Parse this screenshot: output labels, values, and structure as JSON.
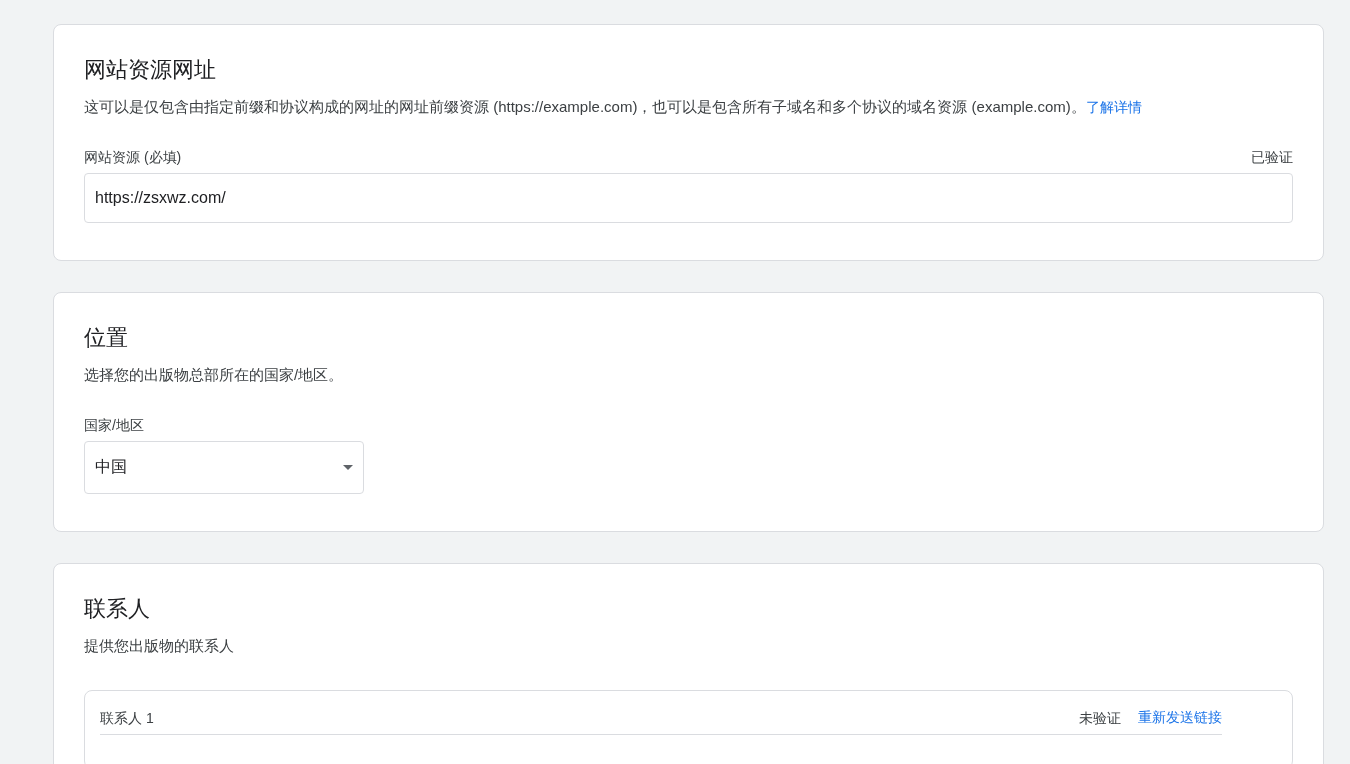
{
  "sections": [
    {
      "kind": "url",
      "title": "网站资源网址",
      "description": "这可以是仅包含由指定前缀和协议构成的网址的网址前缀资源 (https://example.com)，也可以是包含所有子域名和多个协议的域名资源 (example.com)。",
      "link": "了解详情",
      "field": {
        "label": "网站资源 (必填)",
        "status": "已验证",
        "value": "https://zsxwz.com/"
      }
    },
    {
      "kind": "select",
      "title": "位置",
      "description": "选择您的出版物总部所在的国家/地区。",
      "field": {
        "label": "国家/地区",
        "value": "中国"
      }
    },
    {
      "kind": "contacts",
      "title": "联系人",
      "description": "提供您出版物的联系人",
      "contacts": [
        {
          "label": "联系人 1",
          "status": "未验证",
          "action": "重新发送链接"
        }
      ]
    }
  ]
}
